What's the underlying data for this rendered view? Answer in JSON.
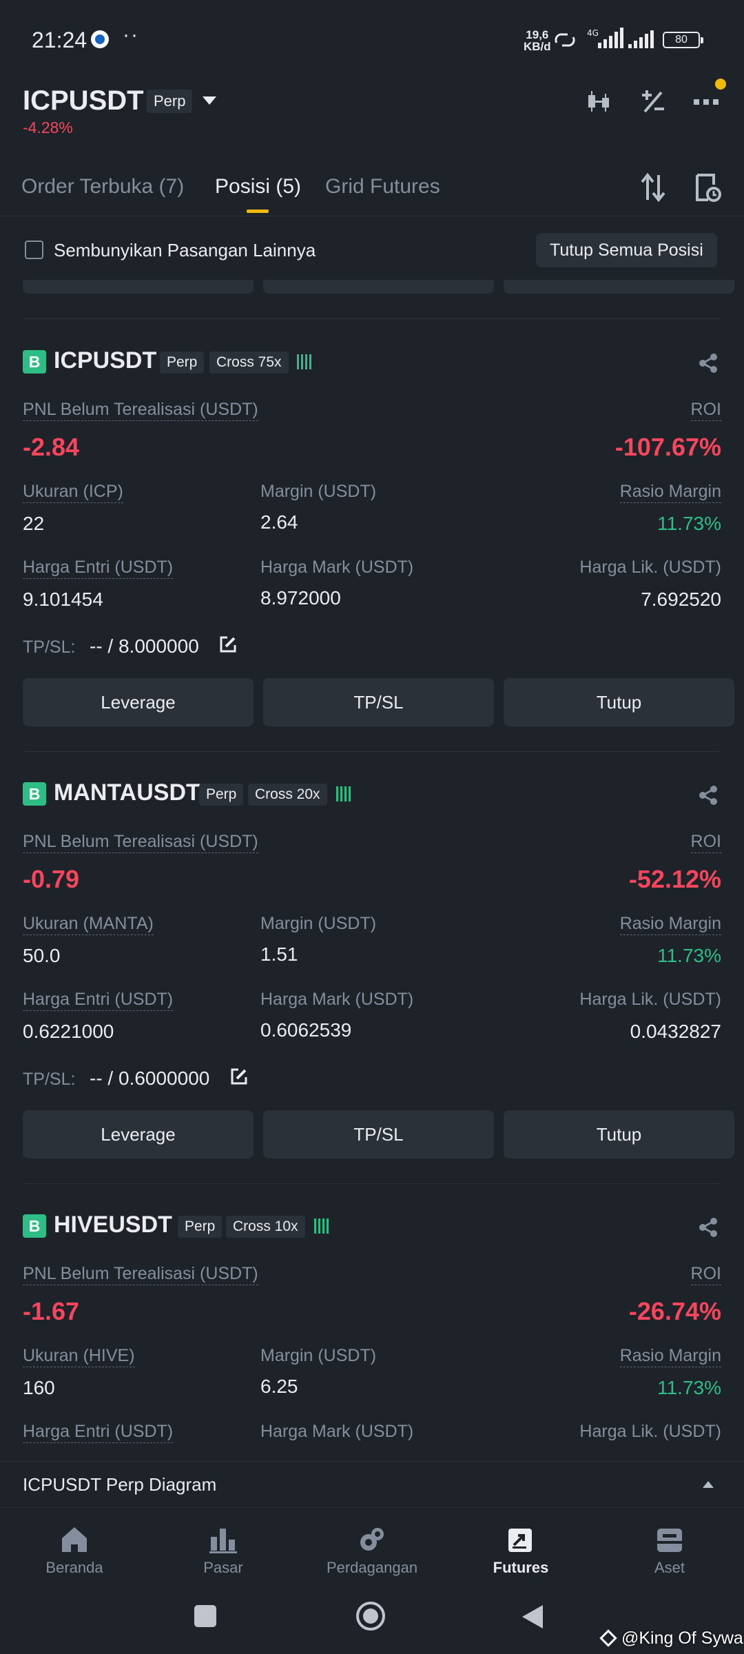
{
  "status_bar": {
    "time": "21:24",
    "dots": "··",
    "speed_value": "19,6",
    "speed_unit": "KB/d",
    "network": "4G",
    "battery": "80"
  },
  "header": {
    "symbol": "ICPUSDT",
    "contract_type": "Perp",
    "change": "-4.28%"
  },
  "tabs": [
    {
      "label": "Order Terbuka (7)"
    },
    {
      "label": "Posisi (5)"
    },
    {
      "label": "Grid Futures"
    }
  ],
  "hide_row": {
    "checkbox_label": "Sembunyikan Pasangan Lainnya",
    "close_all_label": "Tutup Semua Posisi"
  },
  "positions": [
    {
      "side_badge": "B",
      "symbol": "ICPUSDT",
      "type": "Perp",
      "margin_mode": "Cross 75x",
      "pnl_label": "PNL Belum Terealisasi (USDT)",
      "pnl": "-2.84",
      "roi_label": "ROI",
      "roi": "-107.67%",
      "size_label": "Ukuran (ICP)",
      "size": "22",
      "margin_label": "Margin (USDT)",
      "margin": "2.64",
      "margin_ratio_label": "Rasio Margin",
      "margin_ratio": "11.73%",
      "entry_label": "Harga Entri (USDT)",
      "entry": "9.101454",
      "mark_label": "Harga Mark (USDT)",
      "mark": "8.972000",
      "liq_label": "Harga Lik. (USDT)",
      "liq": "7.692520",
      "tpsl_label": "TP/SL:",
      "tpsl": "-- / 8.000000",
      "btn_leverage": "Leverage",
      "btn_tpsl": "TP/SL",
      "btn_close": "Tutup"
    },
    {
      "side_badge": "B",
      "symbol": "MANTAUSDT",
      "type": "Perp",
      "margin_mode": "Cross 20x",
      "pnl_label": "PNL Belum Terealisasi (USDT)",
      "pnl": "-0.79",
      "roi_label": "ROI",
      "roi": "-52.12%",
      "size_label": "Ukuran (MANTA)",
      "size": "50.0",
      "margin_label": "Margin (USDT)",
      "margin": "1.51",
      "margin_ratio_label": "Rasio Margin",
      "margin_ratio": "11.73%",
      "entry_label": "Harga Entri (USDT)",
      "entry": "0.6221000",
      "mark_label": "Harga Mark (USDT)",
      "mark": "0.6062539",
      "liq_label": "Harga Lik. (USDT)",
      "liq": "0.0432827",
      "tpsl_label": "TP/SL:",
      "tpsl": "-- / 0.6000000",
      "btn_leverage": "Leverage",
      "btn_tpsl": "TP/SL",
      "btn_close": "Tutup"
    },
    {
      "side_badge": "B",
      "symbol": "HIVEUSDT",
      "type": "Perp",
      "margin_mode": "Cross 10x",
      "pnl_label": "PNL Belum Terealisasi (USDT)",
      "pnl": "-1.67",
      "roi_label": "ROI",
      "roi": "-26.74%",
      "size_label": "Ukuran (HIVE)",
      "size": "160",
      "margin_label": "Margin (USDT)",
      "margin": "6.25",
      "margin_ratio_label": "Rasio Margin",
      "margin_ratio": "11.73%",
      "entry_label": "Harga Entri (USDT)",
      "mark_label": "Harga Mark (USDT)",
      "liq_label": "Harga Lik. (USDT)"
    }
  ],
  "diagram_bar": {
    "label": "ICPUSDT Perp Diagram"
  },
  "bottom_nav": [
    {
      "label": "Beranda",
      "icon": "home-icon"
    },
    {
      "label": "Pasar",
      "icon": "bar-chart-icon"
    },
    {
      "label": "Perdagangan",
      "icon": "trade-icon"
    },
    {
      "label": "Futures",
      "icon": "futures-icon",
      "active": true
    },
    {
      "label": "Aset",
      "icon": "wallet-icon"
    }
  ],
  "watermark": "@King Of Sywa",
  "colors": {
    "background": "#1e2329",
    "surface": "#2b3139",
    "accent": "#f0b90b",
    "negative": "#f6465d",
    "positive": "#2ebd85",
    "muted": "#848e9c"
  }
}
